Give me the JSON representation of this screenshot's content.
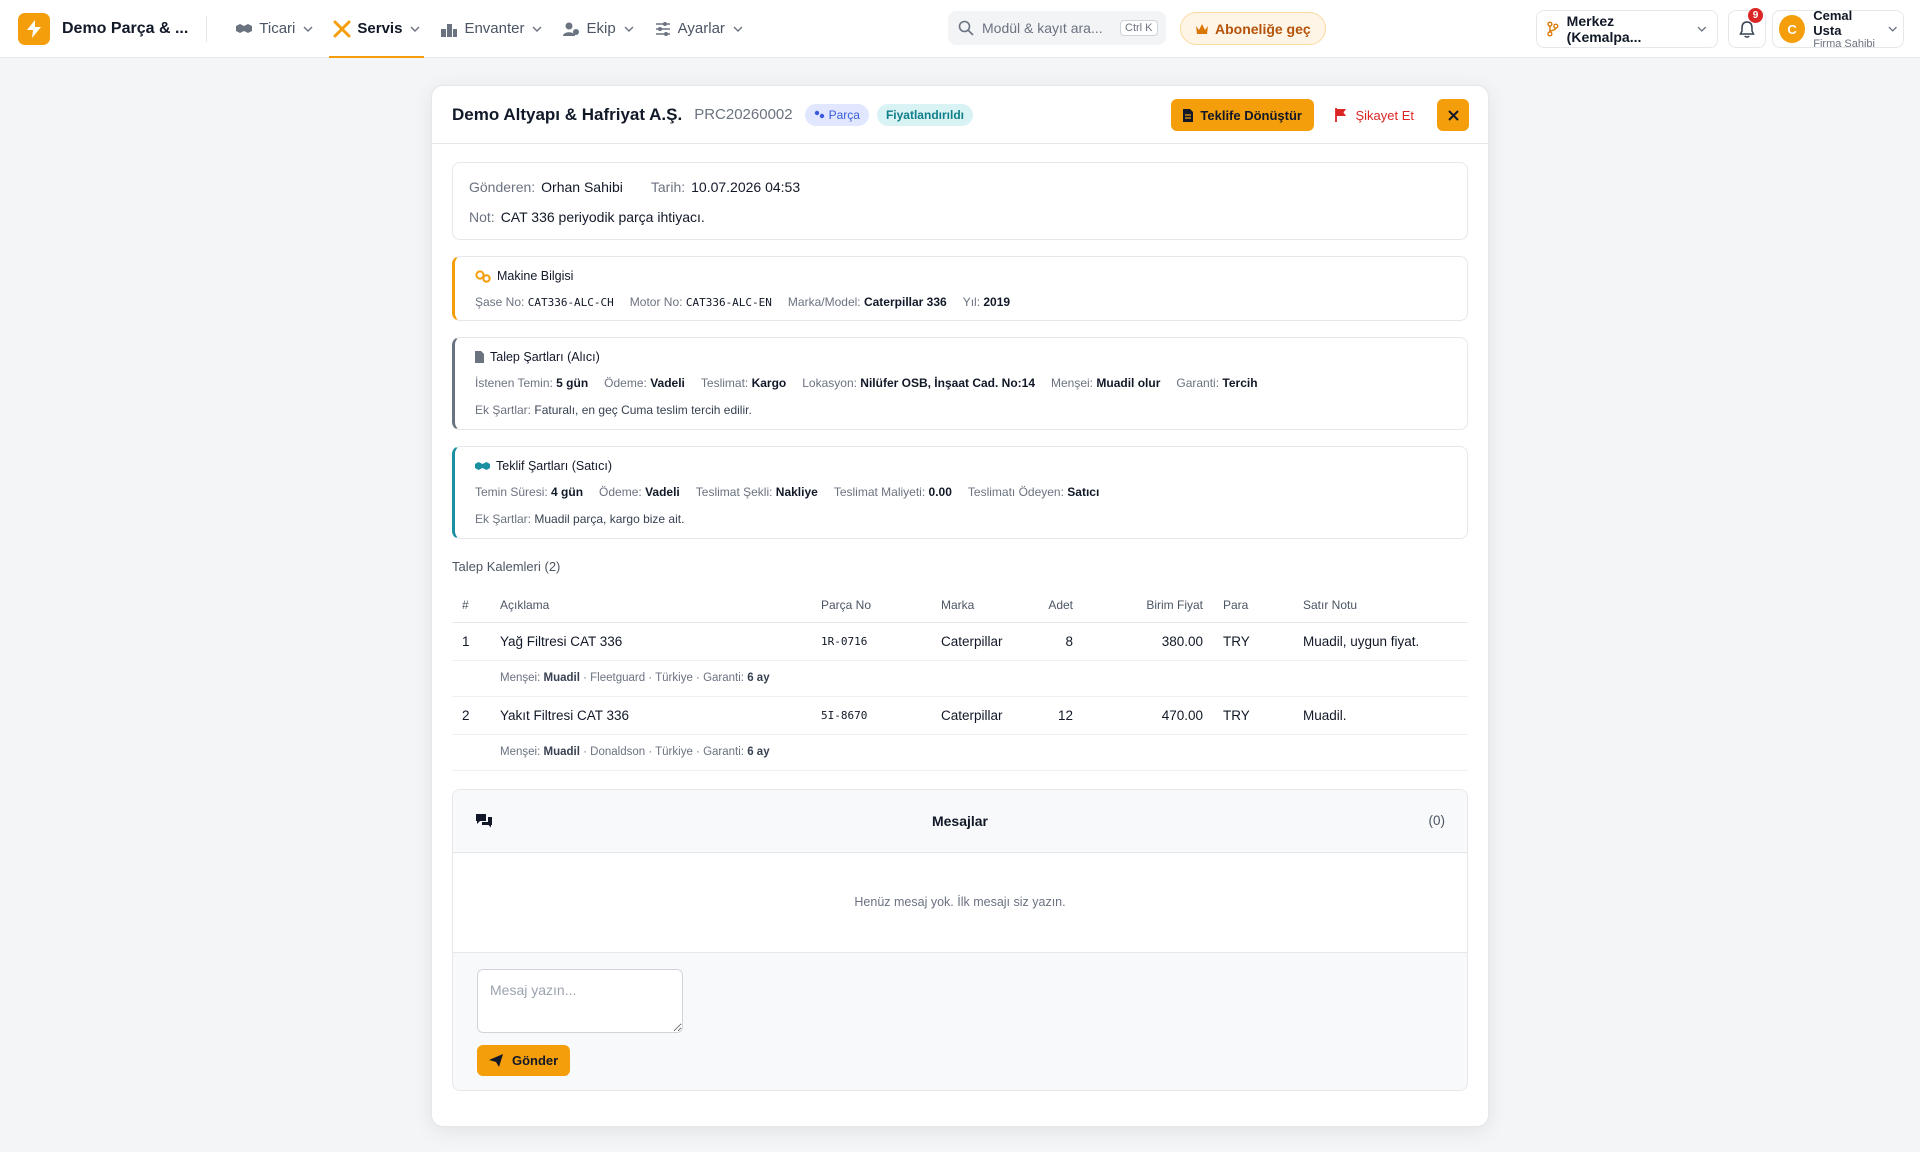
{
  "topnav": {
    "brand": "Demo Parça & ...",
    "nav": [
      {
        "label": "Ticari",
        "icon": "handshake-icon"
      },
      {
        "label": "Servis",
        "icon": "tools-icon",
        "active": true
      },
      {
        "label": "Envanter",
        "icon": "warehouse-icon"
      },
      {
        "label": "Ekip",
        "icon": "users-icon"
      },
      {
        "label": "Ayarlar",
        "icon": "sliders-icon"
      }
    ],
    "search_placeholder": "Modül & kayıt ara...",
    "search_shortcut": "Ctrl K",
    "upgrade_label": "Aboneliğe geç",
    "branch": "Merkez (Kemalpa...",
    "notifications_count": "9",
    "user": {
      "initial": "C",
      "name": "Cemal Usta",
      "role": "Firma Sahibi"
    }
  },
  "modal": {
    "title": "Demo Altyapı & Hafriyat A.Ş.",
    "code": "PRC20260002",
    "type_badge": "Parça",
    "status_badge": "Fiyatlandırıldı",
    "convert_label": "Teklife Dönüştür",
    "complain_label": "Şikayet Et",
    "info": {
      "sender_label": "Gönderen:",
      "sender": "Orhan Sahibi",
      "date_label": "Tarih:",
      "date": "10.07.2026 04:53",
      "note_label": "Not:",
      "note": "CAT 336 periyodik parça ihtiyacı."
    },
    "machine": {
      "title": "Makine Bilgisi",
      "chassis_label": "Şase No:",
      "chassis": "CAT336-ALC-CH",
      "engine_label": "Motor No:",
      "engine": "CAT336-ALC-EN",
      "model_label": "Marka/Model:",
      "model": "Caterpillar 336",
      "year_label": "Yıl:",
      "year": "2019"
    },
    "request_terms": {
      "title": "Talep Şartları (Alıcı)",
      "fields": [
        {
          "label": "İstenen Temin:",
          "value": "5 gün"
        },
        {
          "label": "Ödeme:",
          "value": "Vadeli"
        },
        {
          "label": "Teslimat:",
          "value": "Kargo"
        },
        {
          "label": "Lokasyon:",
          "value": "Nilüfer OSB, İnşaat Cad. No:14"
        },
        {
          "label": "Menşei:",
          "value": "Muadil olur"
        },
        {
          "label": "Garanti:",
          "value": "Tercih"
        }
      ],
      "extra_label": "Ek Şartlar:",
      "extra": "Faturalı, en geç Cuma teslim tercih edilir."
    },
    "offer_terms": {
      "title": "Teklif Şartları (Satıcı)",
      "fields": [
        {
          "label": "Temin Süresi:",
          "value": "4 gün"
        },
        {
          "label": "Ödeme:",
          "value": "Vadeli"
        },
        {
          "label": "Teslimat Şekli:",
          "value": "Nakliye"
        },
        {
          "label": "Teslimat Maliyeti:",
          "value": "0.00"
        },
        {
          "label": "Teslimatı Ödeyen:",
          "value": "Satıcı"
        }
      ],
      "extra_label": "Ek Şartlar:",
      "extra": "Muadil parça, kargo bize ait."
    },
    "items_title": "Talep Kalemleri (2)",
    "columns": [
      "#",
      "Açıklama",
      "Parça No",
      "Marka",
      "Adet",
      "Birim Fiyat",
      "Para",
      "Satır Notu"
    ],
    "items": [
      {
        "no": "1",
        "desc": "Yağ Filtresi CAT 336",
        "part": "1R-0716",
        "brand": "Caterpillar",
        "qty": "8",
        "price": "380.00",
        "cur": "TRY",
        "note": "Muadil, uygun fiyat.",
        "sub": {
          "origin_label": "Menşei:",
          "origin": "Muadil",
          "maker": "Fleetguard",
          "country": "Türkiye",
          "warranty_label": "Garanti:",
          "warranty": "6 ay"
        }
      },
      {
        "no": "2",
        "desc": "Yakıt Filtresi CAT 336",
        "part": "5I-8670",
        "brand": "Caterpillar",
        "qty": "12",
        "price": "470.00",
        "cur": "TRY",
        "note": "Muadil.",
        "sub": {
          "origin_label": "Menşei:",
          "origin": "Muadil",
          "maker": "Donaldson",
          "country": "Türkiye",
          "warranty_label": "Garanti:",
          "warranty": "6 ay"
        }
      }
    ],
    "messages": {
      "title": "Mesajlar",
      "count": "(0)",
      "empty": "Henüz mesaj yok. İlk mesajı siz yazın.",
      "placeholder": "Mesaj yazın...",
      "send_label": "Gönder"
    }
  },
  "colors": {
    "accent": "#f59e0b",
    "danger": "#dc2626",
    "teal": "#1a8fa0"
  }
}
